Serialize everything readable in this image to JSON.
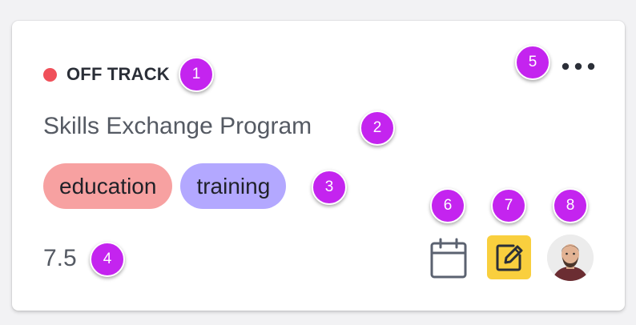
{
  "card": {
    "status": {
      "label": "OFF TRACK",
      "color": "#f0505a"
    },
    "title": "Skills Exchange Program",
    "tags": [
      {
        "label": "education",
        "color": "#f7a1a1"
      },
      {
        "label": "training",
        "color": "#b3a8ff"
      }
    ],
    "score": "7.5",
    "actions": {
      "more_icon": "more-horizontal-icon",
      "calendar_icon": "calendar-icon",
      "note_icon": "edit-note-icon",
      "note_color": "#f9cf3e",
      "avatar": "avatar-photo"
    }
  },
  "markers": [
    "1",
    "2",
    "3",
    "4",
    "5",
    "6",
    "7",
    "8"
  ],
  "marker_color": "#c424ef"
}
